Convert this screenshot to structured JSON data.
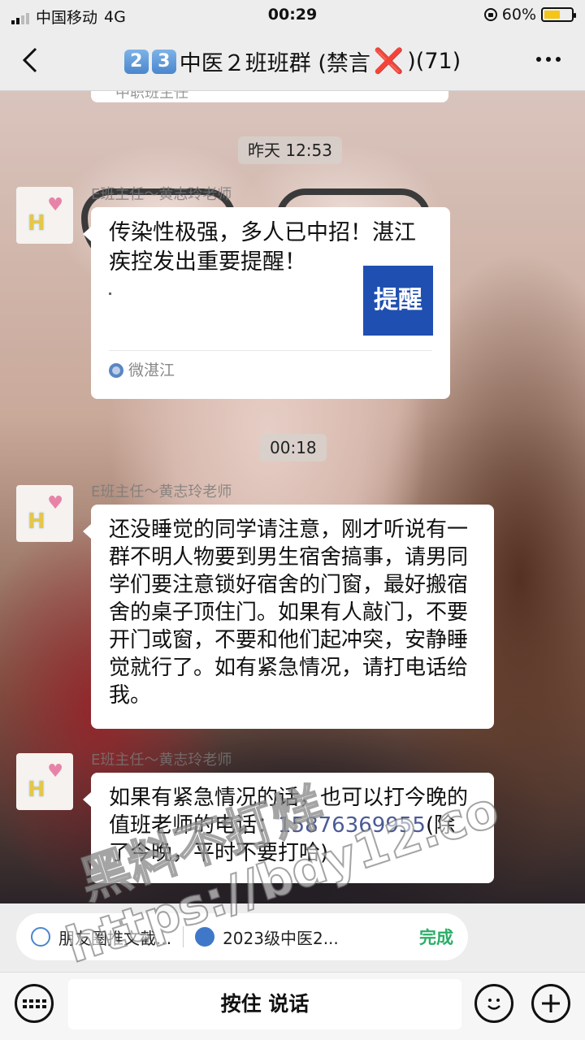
{
  "status_bar": {
    "carrier": "中国移动",
    "network": "4G",
    "time": "00:29",
    "battery": "60%"
  },
  "nav": {
    "badge1": "2",
    "badge2": "3",
    "title_main": "中医２班班群 (禁言",
    "title_mark": "❌",
    "title_count": ")(71)"
  },
  "chat": {
    "top_clip_text": "中职班主任",
    "time1": "昨天 12:53",
    "time2": "00:18",
    "messages": [
      {
        "sender": "E班主任～黄志玲老师",
        "type": "card",
        "title": "传染性极强，多人已中招！湛江疾控发出重要提醒！",
        "dot": ".",
        "thumb_text": "提醒",
        "source": "微湛江"
      },
      {
        "sender": "E班主任～黄志玲老师",
        "type": "text",
        "text": "还没睡觉的同学请注意，刚才听说有一群不明人物要到男生宿舍搞事，请男同学们要注意锁好宿舍的门窗，最好搬宿舍的桌子顶住门。如果有人敲门，不要开门或窗，不要和他们起冲突，安静睡觉就行了。如有紧急情况，请打电话给我。"
      },
      {
        "sender": "E班主任～黄志玲老师",
        "type": "text",
        "text_before": "如果有紧急情况的话，也可以打今晚的值班老师的电话：",
        "phone": "15876369955",
        "text_after": "(除了今晚，平时不要打哈)"
      }
    ]
  },
  "selection_bar": {
    "item1": "朋友圈推文截...",
    "item2": "2023级中医2...",
    "done": "完成"
  },
  "input_bar": {
    "hold_to_talk": "按住 说话"
  },
  "watermark": {
    "line1": "黑料不打烊",
    "line2": "https://bdy12.co"
  },
  "colors": {
    "done_green": "#2aae67",
    "link_blue": "#4a5b95",
    "thumb_blue": "#1f4fb0",
    "x_red": "#e02020"
  }
}
